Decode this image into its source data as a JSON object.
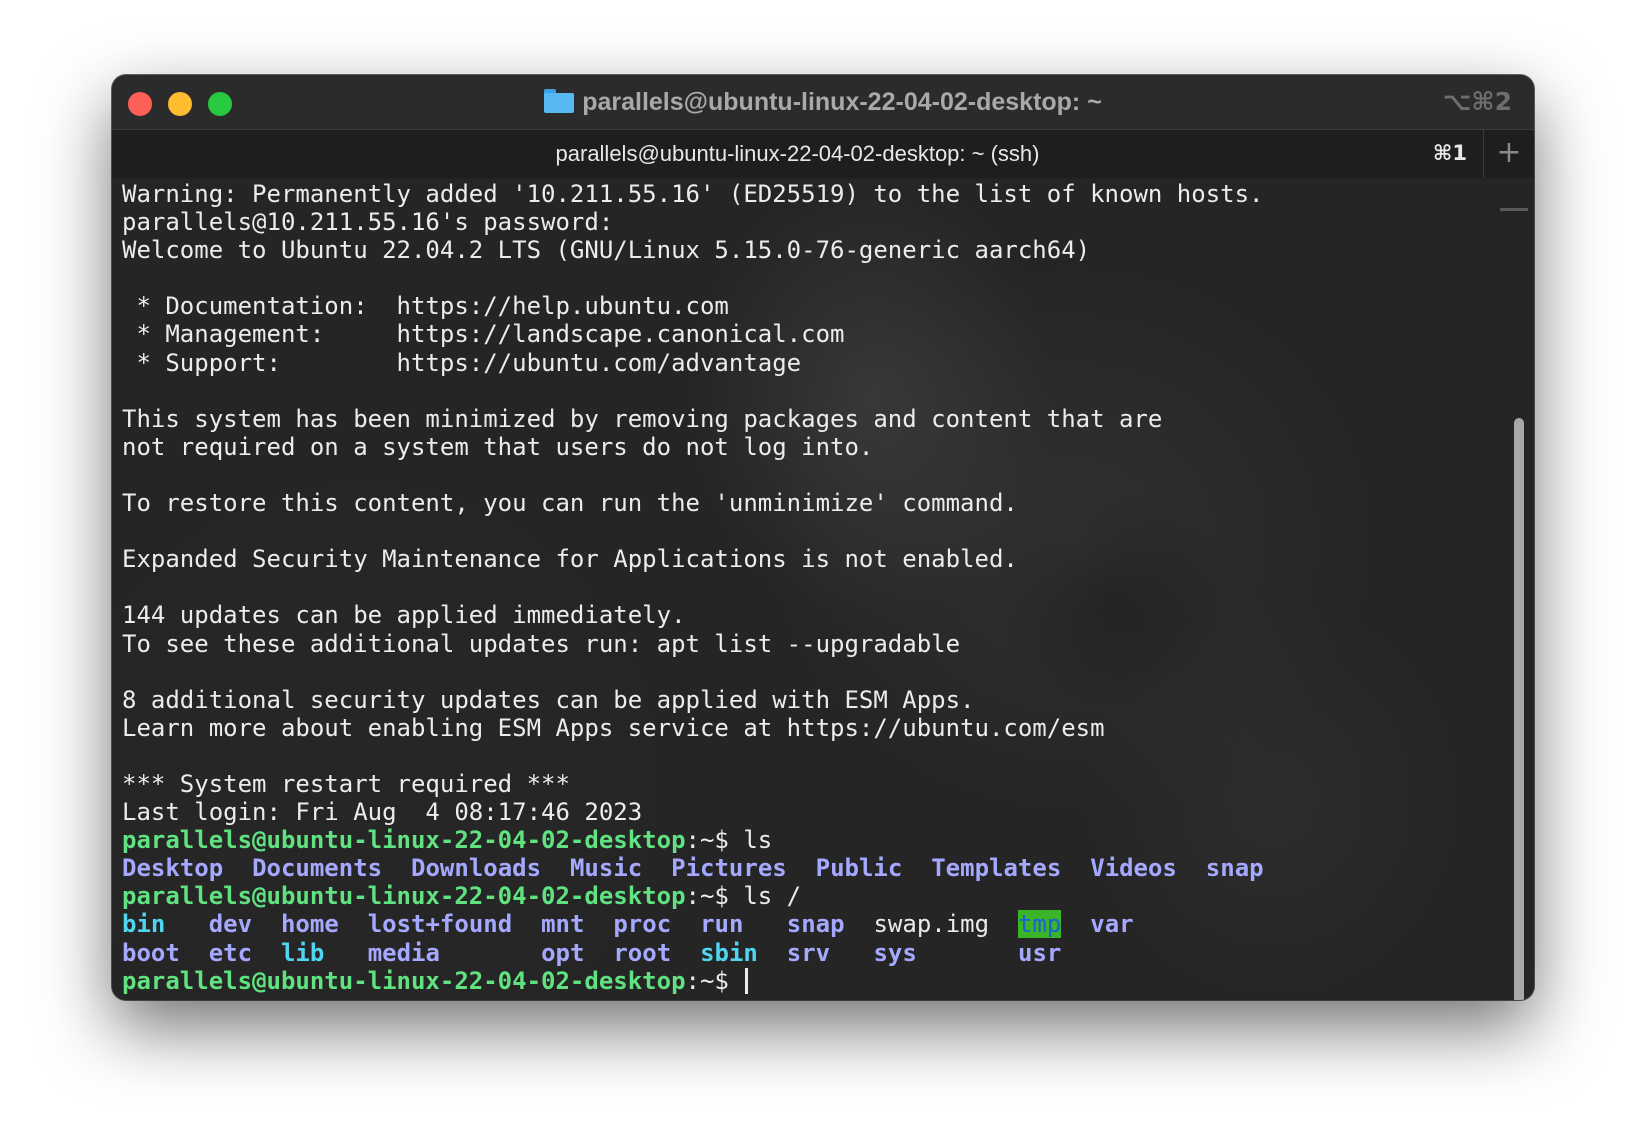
{
  "window": {
    "title": "parallels@ubuntu-linux-22-04-02-desktop: ~",
    "title_icon": "folder-icon",
    "window_shortcut": "⌥⌘2"
  },
  "tabs": [
    {
      "label": "parallels@ubuntu-linux-22-04-02-desktop: ~ (ssh)",
      "shortcut": "⌘1",
      "active": true
    }
  ],
  "new_tab_symbol": "+",
  "terminal": {
    "text_lines": [
      "Warning: Permanently added '10.211.55.16' (ED25519) to the list of known hosts.",
      "parallels@10.211.55.16's password:",
      "Welcome to Ubuntu 22.04.2 LTS (GNU/Linux 5.15.0-76-generic aarch64)",
      "",
      " * Documentation:  https://help.ubuntu.com",
      " * Management:     https://landscape.canonical.com",
      " * Support:        https://ubuntu.com/advantage",
      "",
      "This system has been minimized by removing packages and content that are",
      "not required on a system that users do not log into.",
      "",
      "To restore this content, you can run the 'unminimize' command.",
      "",
      "Expanded Security Maintenance for Applications is not enabled.",
      "",
      "144 updates can be applied immediately.",
      "To see these additional updates run: apt list --upgradable",
      "",
      "8 additional security updates can be applied with ESM Apps.",
      "Learn more about enabling ESM Apps service at https://ubuntu.com/esm",
      "",
      "*** System restart required ***",
      "Last login: Fri Aug  4 08:17:46 2023"
    ],
    "prompt_user_host": "parallels@ubuntu-linux-22-04-02-desktop",
    "prompt_suffix": ":~$ ",
    "command_1": "ls",
    "home_listing": [
      "Desktop",
      "Documents",
      "Downloads",
      "Music",
      "Pictures",
      "Public",
      "Templates",
      "Videos",
      "snap"
    ],
    "command_2": "ls /",
    "root_listing_row1": [
      {
        "name": "bin",
        "kind": "link"
      },
      {
        "name": "dev",
        "kind": "dir"
      },
      {
        "name": "home",
        "kind": "dir"
      },
      {
        "name": "lost+found",
        "kind": "dir"
      },
      {
        "name": "mnt",
        "kind": "dir"
      },
      {
        "name": "proc",
        "kind": "dir"
      },
      {
        "name": "run",
        "kind": "dir"
      },
      {
        "name": "snap",
        "kind": "dir"
      },
      {
        "name": "swap.img",
        "kind": "file"
      },
      {
        "name": "tmp",
        "kind": "sticky"
      },
      {
        "name": "var",
        "kind": "dir"
      }
    ],
    "root_listing_row2": [
      {
        "name": "boot",
        "kind": "dir"
      },
      {
        "name": "etc",
        "kind": "dir"
      },
      {
        "name": "lib",
        "kind": "link"
      },
      {
        "name": "media",
        "kind": "dir"
      },
      {
        "name": "",
        "kind": "empty"
      },
      {
        "name": "opt",
        "kind": "dir"
      },
      {
        "name": "root",
        "kind": "dir"
      },
      {
        "name": "sbin",
        "kind": "link"
      },
      {
        "name": "srv",
        "kind": "dir"
      },
      {
        "name": "sys",
        "kind": "dir"
      },
      {
        "name": "",
        "kind": "empty"
      },
      {
        "name": "usr",
        "kind": "dir"
      }
    ]
  },
  "colors": {
    "prompt": "#5fe27f",
    "directory": "#a4a9ff",
    "symlink": "#4fd6ee",
    "sticky_bg": "#3ab52a",
    "text": "#ececec"
  }
}
